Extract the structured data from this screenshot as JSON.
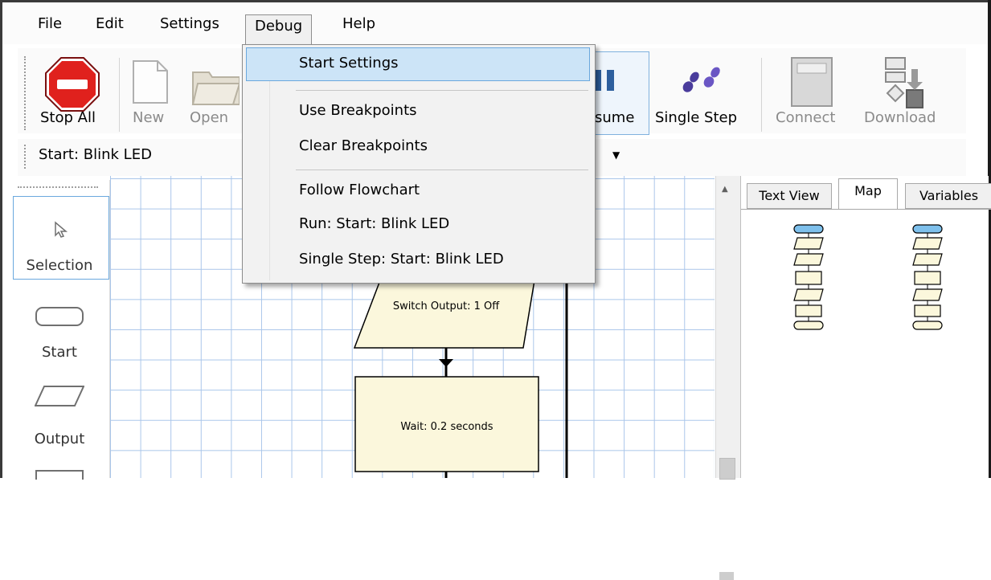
{
  "menubar": {
    "items": [
      "File",
      "Edit",
      "Settings",
      "Debug",
      "Help"
    ],
    "active": "Debug"
  },
  "toolbar": {
    "stop_all": "Stop All",
    "new": "New",
    "open": "Open",
    "resume_partial": "sume",
    "single_step": "Single Step",
    "connect": "Connect",
    "download": "Download"
  },
  "start_selector": {
    "value": "Start: Blink LED"
  },
  "palette": {
    "items": [
      "Selection",
      "Start",
      "Output"
    ]
  },
  "debug_menu": {
    "items": [
      "Start Settings",
      "Use Breakpoints",
      "Clear Breakpoints",
      "Follow Flowchart",
      "Run: Start: Blink LED",
      "Single Step: Start: Blink LED"
    ],
    "highlighted": "Start Settings"
  },
  "flowchart": {
    "output_block": "Switch Output: 1 Off",
    "wait_block": "Wait: 0.2 seconds"
  },
  "right_panel": {
    "tabs": [
      "Text View",
      "Map",
      "Variables"
    ],
    "selected_tab": "Map"
  },
  "colors": {
    "grid": "#aac6ea",
    "block_fill": "#fbf7dc",
    "menu_highlight": "#cce4f7",
    "stop_red": "#e0211d",
    "map_start": "#7ec0ec"
  }
}
